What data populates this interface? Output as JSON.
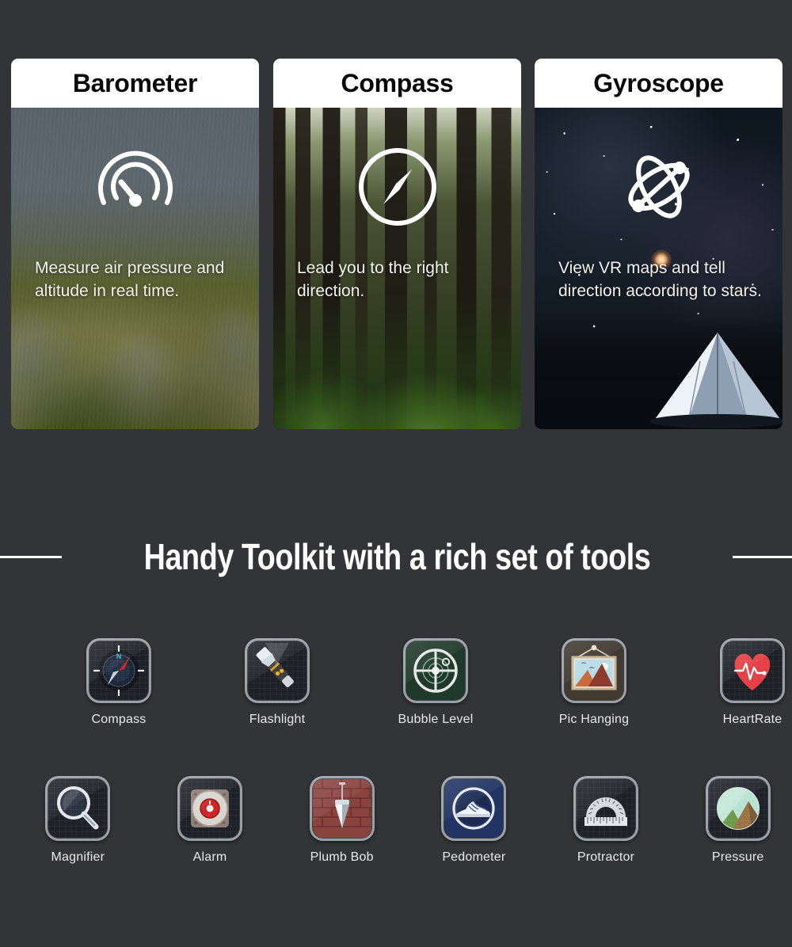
{
  "cards": [
    {
      "title": "Barometer",
      "description": "Measure air pressure and altitude in real time.",
      "icon": "barometer-gauge-icon",
      "photo": "mountain-ridge-photo"
    },
    {
      "title": "Compass",
      "description": "Lead you to the right direction.",
      "icon": "compass-needle-icon",
      "photo": "forest-photo"
    },
    {
      "title": "Gyroscope",
      "description": "View VR maps and tell direction according to stars.",
      "icon": "atom-orbit-icon",
      "photo": "night-sky-tent-photo"
    }
  ],
  "section": {
    "headline": "Handy Toolkit with a rich set of tools"
  },
  "tools": {
    "row1": [
      {
        "label": "Compass",
        "icon": "compass-app-icon"
      },
      {
        "label": "Flashlight",
        "icon": "flashlight-app-icon"
      },
      {
        "label": "Bubble Level",
        "icon": "bubble-level-app-icon"
      },
      {
        "label": "Pic Hanging",
        "icon": "picture-hanging-app-icon"
      },
      {
        "label": "HeartRate",
        "icon": "heart-rate-app-icon"
      }
    ],
    "row2": [
      {
        "label": "Magnifier",
        "icon": "magnifier-app-icon"
      },
      {
        "label": "Alarm",
        "icon": "alarm-button-app-icon"
      },
      {
        "label": "Plumb Bob",
        "icon": "plumb-bob-app-icon"
      },
      {
        "label": "Pedometer",
        "icon": "pedometer-shoe-app-icon"
      },
      {
        "label": "Protractor",
        "icon": "protractor-app-icon"
      },
      {
        "label": "Pressure",
        "icon": "pressure-landscape-app-icon"
      }
    ]
  },
  "colors": {
    "background": "#323437",
    "card_title_bg": "#ffffff",
    "headline_text": "#ffffff",
    "label_text": "#e9e9ea"
  }
}
